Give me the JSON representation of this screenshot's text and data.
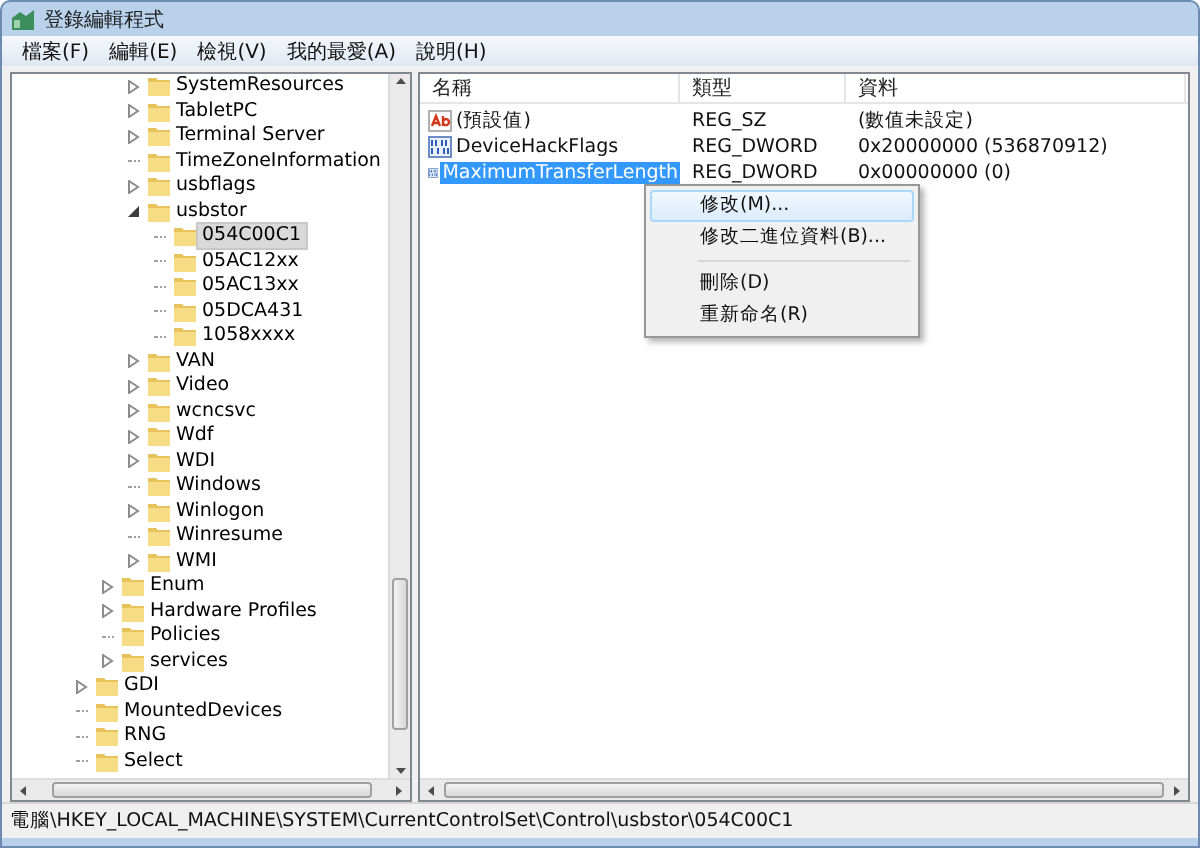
{
  "window": {
    "title": "登錄編輯程式"
  },
  "menu": [
    "檔案(F)",
    "編輯(E)",
    "檢視(V)",
    "我的最愛(A)",
    "說明(H)"
  ],
  "tree": {
    "items": [
      {
        "children": [
          {
            "children": [
              {
                "label": "SystemResources",
                "expanded": false,
                "selected": false
              },
              {
                "label": "TabletPC",
                "expanded": false,
                "selected": false
              },
              {
                "label": "Terminal Server",
                "expanded": false,
                "selected": false
              },
              {
                "label": "TimeZoneInformation",
                "selected": false
              },
              {
                "label": "usbflags",
                "expanded": false,
                "selected": false
              },
              {
                "label": "usbstor",
                "expanded": true,
                "selected": false,
                "children": [
                  {
                    "label": "054C00C1",
                    "selected": true
                  },
                  {
                    "label": "05AC12xx",
                    "selected": false
                  },
                  {
                    "label": "05AC13xx",
                    "selected": false
                  },
                  {
                    "label": "05DCA431",
                    "selected": false
                  },
                  {
                    "label": "1058xxxx",
                    "selected": false
                  }
                ]
              },
              {
                "label": "VAN",
                "expanded": false,
                "selected": false
              },
              {
                "label": "Video",
                "expanded": false,
                "selected": false
              },
              {
                "label": "wcncsvc",
                "expanded": false,
                "selected": false
              },
              {
                "label": "Wdf",
                "expanded": false,
                "selected": false
              },
              {
                "label": "WDI",
                "expanded": false,
                "selected": false
              },
              {
                "label": "Windows",
                "selected": false
              },
              {
                "label": "Winlogon",
                "expanded": false,
                "selected": false
              },
              {
                "label": "Winresume",
                "selected": false
              },
              {
                "label": "WMI",
                "expanded": false,
                "selected": false
              }
            ]
          },
          {
            "label": "Enum",
            "expanded": false,
            "selected": false
          },
          {
            "label": "Hardware Profiles",
            "expanded": false,
            "selected": false
          },
          {
            "label": "Policies",
            "selected": false
          },
          {
            "label": "services",
            "expanded": false,
            "selected": false
          }
        ]
      },
      {
        "label": "GDI",
        "expanded": false,
        "selected": false
      },
      {
        "label": "MountedDevices",
        "selected": false
      },
      {
        "label": "RNG",
        "selected": false
      },
      {
        "label": "Select",
        "selected": false
      }
    ]
  },
  "list": {
    "columns": [
      "名稱",
      "類型",
      "資料"
    ],
    "rows": [
      {
        "kind": "string",
        "name": "(預設值)",
        "type": "REG_SZ",
        "data": "(數值未設定)",
        "selected": false
      },
      {
        "kind": "binary",
        "name": "DeviceHackFlags",
        "type": "REG_DWORD",
        "data": "0x20000000 (536870912)",
        "selected": false
      },
      {
        "kind": "binary",
        "name": "MaximumTransferLength",
        "type": "REG_DWORD",
        "data": "0x00000000 (0)",
        "selected": true
      }
    ]
  },
  "context_menu": [
    {
      "kind": "item",
      "label": "修改(M)...",
      "selected": true
    },
    {
      "kind": "item",
      "label": "修改二進位資料(B)...",
      "selected": false
    },
    {
      "kind": "separator"
    },
    {
      "kind": "item",
      "label": "刪除(D)",
      "selected": false
    },
    {
      "kind": "item",
      "label": "重新命名(R)",
      "selected": false
    }
  ],
  "status_bar": "電腦\\HKEY_LOCAL_MACHINE\\SYSTEM\\CurrentControlSet\\Control\\usbstor\\054C00C1"
}
